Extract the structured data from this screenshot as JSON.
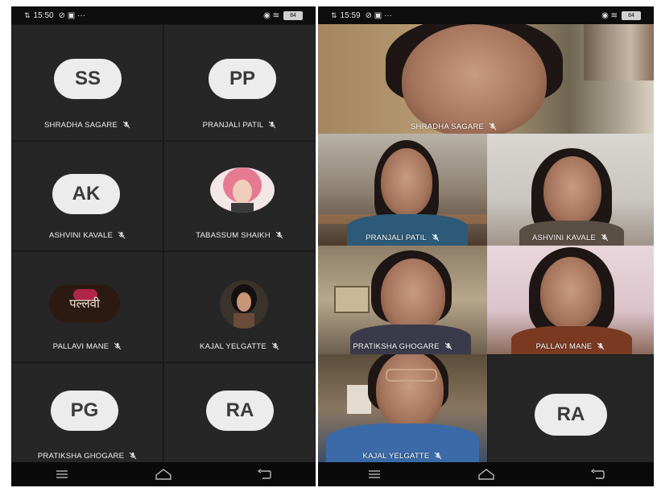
{
  "left_phone": {
    "status": {
      "signal": "⇅",
      "time": "15:50",
      "icons": "⊘ ▣ ···",
      "right_icons": "◉ ≋",
      "battery": "84"
    },
    "participants": [
      {
        "initials": "SS",
        "name": "SHRADHA SAGARE"
      },
      {
        "initials": "PP",
        "name": "PRANJALI PATIL"
      },
      {
        "initials": "AK",
        "name": "ASHVINI KAVALE"
      },
      {
        "initials": "",
        "name": "TABASSUM SHAIKH"
      },
      {
        "initials": "",
        "name": "PALLAVI MANE",
        "badge_text": "पल्लवी"
      },
      {
        "initials": "",
        "name": "KAJAL YELGATTE"
      },
      {
        "initials": "PG",
        "name": "PRATIKSHA GHOGARE"
      },
      {
        "initials": "RA",
        "name": ""
      }
    ]
  },
  "right_phone": {
    "status": {
      "signal": "⇅",
      "time": "15:59",
      "icons": "⊘ ▣ ···",
      "right_icons": "◉ ≋",
      "battery": "84"
    },
    "participants": [
      {
        "name": "SHRADHA SAGARE"
      },
      {
        "name": "PRANJALI PATIL"
      },
      {
        "name": "ASHVINI KAVALE"
      },
      {
        "name": "PRATIKSHA GHOGARE"
      },
      {
        "name": "PALLAVI MANE"
      },
      {
        "name": "KAJAL YELGATTE"
      },
      {
        "initials": "RA",
        "name": ""
      }
    ]
  },
  "colors": {
    "tile_dark": "#262626",
    "avatar_bg": "#ececec",
    "label": "#f0f0f0"
  }
}
